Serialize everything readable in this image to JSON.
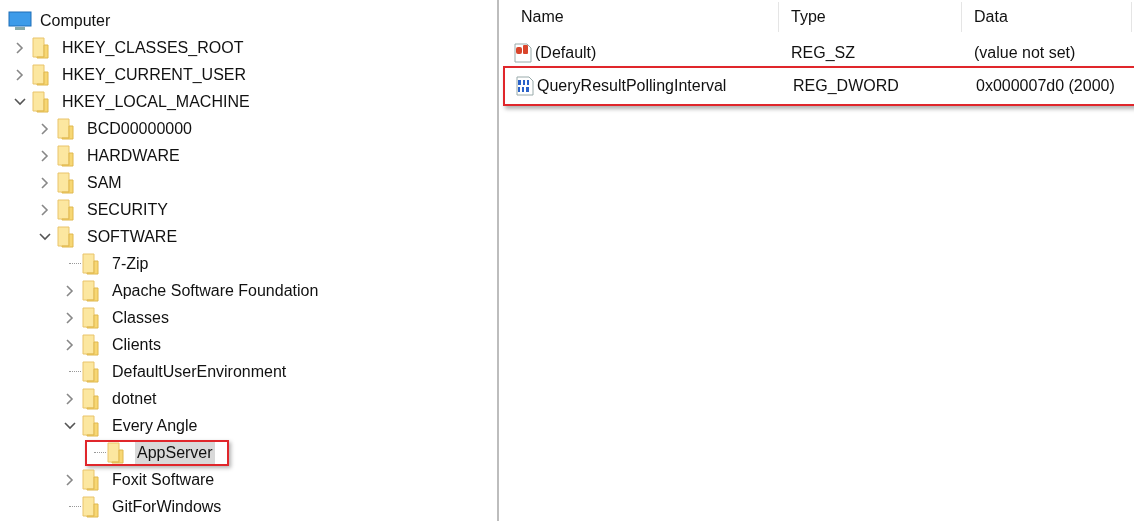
{
  "tree": {
    "label": "Computer",
    "selected": false,
    "highlighted": false,
    "children": [
      {
        "label": "HKEY_CLASSES_ROOT",
        "kind": "branch",
        "expanded": false,
        "selected": false,
        "highlighted": false
      },
      {
        "label": "HKEY_CURRENT_USER",
        "kind": "branch",
        "expanded": false,
        "selected": false,
        "highlighted": false
      },
      {
        "label": "HKEY_LOCAL_MACHINE",
        "kind": "branch",
        "expanded": true,
        "selected": false,
        "highlighted": false,
        "children": [
          {
            "label": "BCD00000000",
            "kind": "branch",
            "expanded": false,
            "selected": false,
            "highlighted": false
          },
          {
            "label": "HARDWARE",
            "kind": "branch",
            "expanded": false,
            "selected": false,
            "highlighted": false
          },
          {
            "label": "SAM",
            "kind": "branch",
            "expanded": false,
            "selected": false,
            "highlighted": false
          },
          {
            "label": "SECURITY",
            "kind": "branch",
            "expanded": false,
            "selected": false,
            "highlighted": false
          },
          {
            "label": "SOFTWARE",
            "kind": "branch",
            "expanded": true,
            "selected": false,
            "highlighted": false,
            "children": [
              {
                "label": "7-Zip",
                "kind": "leaf",
                "selected": false,
                "highlighted": false
              },
              {
                "label": "Apache Software Foundation",
                "kind": "branch",
                "expanded": false,
                "selected": false,
                "highlighted": false
              },
              {
                "label": "Classes",
                "kind": "branch",
                "expanded": false,
                "selected": false,
                "highlighted": false
              },
              {
                "label": "Clients",
                "kind": "branch",
                "expanded": false,
                "selected": false,
                "highlighted": false
              },
              {
                "label": "DefaultUserEnvironment",
                "kind": "leaf",
                "selected": false,
                "highlighted": false
              },
              {
                "label": "dotnet",
                "kind": "branch",
                "expanded": false,
                "selected": false,
                "highlighted": false
              },
              {
                "label": "Every Angle",
                "kind": "branch",
                "expanded": true,
                "selected": false,
                "highlighted": false,
                "children": [
                  {
                    "label": "AppServer",
                    "kind": "leaf",
                    "selected": true,
                    "highlighted": true
                  }
                ]
              },
              {
                "label": "Foxit Software",
                "kind": "branch",
                "expanded": false,
                "selected": false,
                "highlighted": false
              },
              {
                "label": "GitForWindows",
                "kind": "leaf",
                "selected": false,
                "highlighted": false
              }
            ]
          }
        ]
      }
    ]
  },
  "values": {
    "columns": [
      "Name",
      "Type",
      "Data"
    ],
    "rows": [
      {
        "kind": "string",
        "name": "(Default)",
        "type": "REG_SZ",
        "data": "(value not set)",
        "highlighted": false
      },
      {
        "kind": "dword",
        "name": "QueryResultPollingInterval",
        "type": "REG_DWORD",
        "data": "0x000007d0 (2000)",
        "highlighted": true
      }
    ]
  }
}
